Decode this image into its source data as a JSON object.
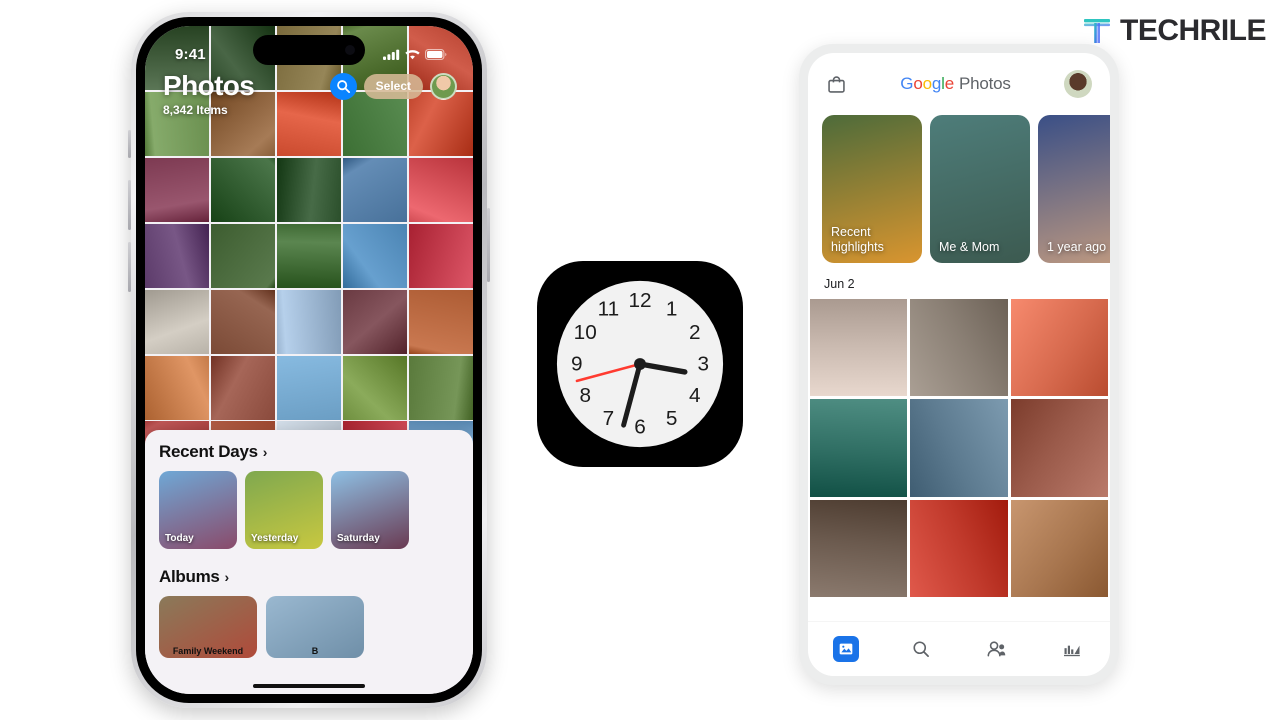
{
  "brand": {
    "name": "TECHRILE",
    "mark": "techrile-t-logo",
    "colors": {
      "teal": "#2ec5c0",
      "blue": "#4a6cf7",
      "text": "#2b2b2f"
    }
  },
  "iphone": {
    "status": {
      "time": "9:41",
      "icons": [
        "cellular-bars-icon",
        "wifi-icon",
        "battery-icon"
      ]
    },
    "header": {
      "title": "Photos",
      "subtitle": "8,342 Items",
      "search_icon": "search-icon",
      "select_label": "Select",
      "avatar": "user-avatar"
    },
    "grid": {
      "columns": 5,
      "rows": 7,
      "tiles": [
        "#3f5a3a",
        "#2d4a2a",
        "#7a6a3c",
        "#4e6e2f",
        "#b5412f",
        "#6a8f4f",
        "#8a5f3a",
        "#ca4a2e",
        "#3c6f34",
        "#c0452d",
        "#7d3a52",
        "#2f5a2e",
        "#2b4f2b",
        "#48719a",
        "#d14c54",
        "#5c3b6a",
        "#3d5d30",
        "#3f6a34",
        "#4b84b3",
        "#c0394a",
        "#b8b2a8",
        "#7b4a36",
        "#9ab4cf",
        "#6a3a42",
        "#ad5c34",
        "#c47a49",
        "#8a4a3c",
        "#6b9ec4",
        "#6f8f3f",
        "#5a7a3c",
        "#a23a3a",
        "#9d4830",
        "#b9c4cf",
        "#c03b47",
        "#6f9ec7"
      ]
    },
    "sheet": {
      "recent_days": {
        "title": "Recent Days",
        "chevron": "chevron-right-icon",
        "cards": [
          {
            "label": "Today",
            "color1": "#6fa8d6",
            "color2": "#8a4a6a"
          },
          {
            "label": "Yesterday",
            "color1": "#7fa84f",
            "color2": "#c8c840"
          },
          {
            "label": "Saturday",
            "color1": "#8ec0e4",
            "color2": "#6a3a52"
          }
        ]
      },
      "albums": {
        "title": "Albums",
        "chevron": "chevron-right-icon",
        "cards": [
          {
            "label": "Family Weekend",
            "color1": "#8a7a5a",
            "color2": "#b04a3a"
          },
          {
            "label": "B",
            "color1": "#9ab8d0",
            "color2": "#6f8fa8"
          }
        ]
      }
    }
  },
  "clock_icon": {
    "name": "ios-clock-icon",
    "hours": [
      "12",
      "1",
      "2",
      "3",
      "4",
      "5",
      "6",
      "7",
      "8",
      "9",
      "10",
      "11"
    ],
    "hour_hand_deg": 100,
    "minute_hand_deg": 195,
    "second_hand_deg": 255,
    "face_color": "#f2f2f2",
    "case_color": "#000000",
    "second_hand_color": "#ff3b30"
  },
  "android": {
    "header": {
      "bag_icon": "shopping-bag-icon",
      "logo_google": "Google",
      "logo_photos": "Photos",
      "avatar": "user-avatar",
      "google_colors": [
        "#4285f4",
        "#ea4335",
        "#fbbc05",
        "#4285f4",
        "#34a853",
        "#ea4335"
      ]
    },
    "memories": [
      {
        "label": "Recent\nhighlights",
        "line1": "Recent",
        "line2": "highlights",
        "color1": "#4d6b3a",
        "color2": "#d9952f"
      },
      {
        "label": "Me & Mom",
        "line1": "Me & Mom",
        "line2": "",
        "color1": "#4e7d7a",
        "color2": "#3c5a50"
      },
      {
        "label": "1 year ago",
        "line1": "1 year ago",
        "line2": "",
        "color1": "#3a4f86",
        "color2": "#c09a80"
      }
    ],
    "date_header": "Jun 2",
    "grid": {
      "columns": 3,
      "tiles": [
        "#c8b8ae",
        "#8a7f74",
        "#d76a4e",
        "#2f6e63",
        "#5d7b90",
        "#9a5a4a",
        "#6b5a4e",
        "#c0392b",
        "#a8764f"
      ]
    },
    "nav": [
      {
        "name": "photos-tab",
        "icon": "photo-icon",
        "active": true
      },
      {
        "name": "search-tab",
        "icon": "search-icon",
        "active": false
      },
      {
        "name": "sharing-tab",
        "icon": "people-icon",
        "active": false
      },
      {
        "name": "library-tab",
        "icon": "collections-icon",
        "active": false
      }
    ]
  }
}
